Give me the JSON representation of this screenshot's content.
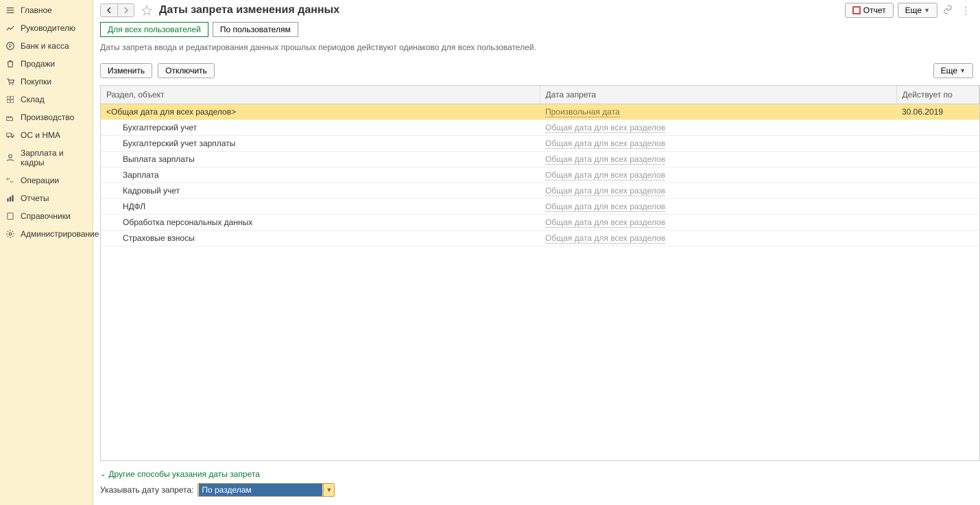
{
  "sidebar": {
    "items": [
      {
        "icon": "menu",
        "label": "Главное"
      },
      {
        "icon": "chart",
        "label": "Руководителю"
      },
      {
        "icon": "bank",
        "label": "Банк и касса"
      },
      {
        "icon": "bag",
        "label": "Продажи"
      },
      {
        "icon": "cart",
        "label": "Покупки"
      },
      {
        "icon": "boxes",
        "label": "Склад"
      },
      {
        "icon": "factory",
        "label": "Производство"
      },
      {
        "icon": "truck",
        "label": "ОС и НМА"
      },
      {
        "icon": "person",
        "label": "Зарплата и кадры"
      },
      {
        "icon": "ops",
        "label": "Операции"
      },
      {
        "icon": "bars",
        "label": "Отчеты"
      },
      {
        "icon": "book",
        "label": "Справочники"
      },
      {
        "icon": "gear",
        "label": "Администрирование"
      }
    ]
  },
  "header": {
    "title": "Даты запрета изменения данных",
    "report_btn": "Отчет",
    "more_btn": "Еще"
  },
  "tabs": {
    "all_users": "Для всех пользователей",
    "by_users": "По пользователям"
  },
  "description": "Даты запрета ввода и редактирования данных прошлых периодов действуют одинаково для всех пользователей.",
  "actions": {
    "edit": "Изменить",
    "disable": "Отключить",
    "more": "Еще"
  },
  "table": {
    "columns": {
      "section": "Раздел, объект",
      "ban_date": "Дата запрета",
      "effective": "Действует по"
    },
    "rows": [
      {
        "section": "<Общая дата для всех разделов>",
        "date_link": "Произвольная дата",
        "effective": "30.06.2019",
        "selected": true,
        "active_link": true,
        "indent": false
      },
      {
        "section": "Бухгалтерский учет",
        "date_link": "Общая дата для всех разделов",
        "effective": "",
        "selected": false,
        "active_link": false,
        "indent": true
      },
      {
        "section": "Бухгалтерский учет зарплаты",
        "date_link": "Общая дата для всех разделов",
        "effective": "",
        "selected": false,
        "active_link": false,
        "indent": true
      },
      {
        "section": "Выплата зарплаты",
        "date_link": "Общая дата для всех разделов",
        "effective": "",
        "selected": false,
        "active_link": false,
        "indent": true
      },
      {
        "section": "Зарплата",
        "date_link": "Общая дата для всех разделов",
        "effective": "",
        "selected": false,
        "active_link": false,
        "indent": true
      },
      {
        "section": "Кадровый учет",
        "date_link": "Общая дата для всех разделов",
        "effective": "",
        "selected": false,
        "active_link": false,
        "indent": true
      },
      {
        "section": "НДФЛ",
        "date_link": "Общая дата для всех разделов",
        "effective": "",
        "selected": false,
        "active_link": false,
        "indent": true
      },
      {
        "section": "Обработка персональных данных",
        "date_link": "Общая дата для всех разделов",
        "effective": "",
        "selected": false,
        "active_link": false,
        "indent": true
      },
      {
        "section": "Страховые взносы",
        "date_link": "Общая дата для всех разделов",
        "effective": "",
        "selected": false,
        "active_link": false,
        "indent": true
      }
    ]
  },
  "bottom": {
    "collapse_title": "Другие способы указания даты запрета",
    "select_label": "Указывать дату запрета:",
    "select_value": "По разделам"
  }
}
